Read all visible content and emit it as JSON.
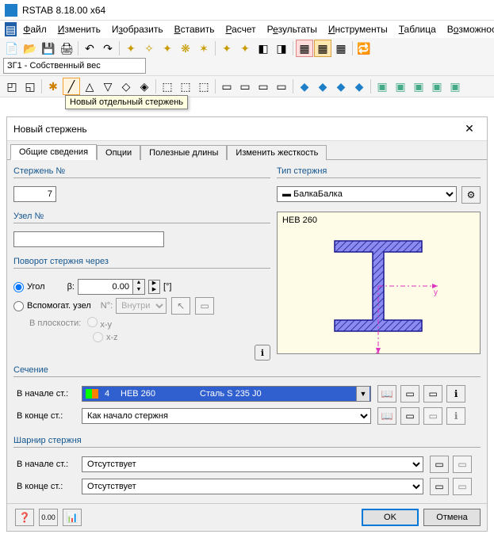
{
  "app": {
    "title": "RSTAB 8.18.00 x64"
  },
  "menu": [
    "Файл",
    "Изменить",
    "Изобразить",
    "Вставить",
    "Расчет",
    "Результаты",
    "Инструменты",
    "Таблица",
    "Возможности"
  ],
  "toolbar": {
    "loadcase": "ЗГ1 - Собственный вес",
    "tooltip": "Новый отдельный стержень"
  },
  "dialog": {
    "title": "Новый стержень",
    "tabs": [
      "Общие сведения",
      "Опции",
      "Полезные длины",
      "Изменить жесткость"
    ],
    "member_no_label": "Стержень №",
    "member_no": "7",
    "type_label": "Тип стержня",
    "type_value": "Балка",
    "node_label": "Узел №",
    "node_value": "",
    "preview_label": "HEB 260",
    "rotation_label": "Поворот стержня через",
    "angle_label": "Угол",
    "beta_label": "β:",
    "beta_value": "0.00",
    "beta_unit": "[°]",
    "helpnode_label": "Вспомогат. узел",
    "inside_label": "Внутри",
    "plane_label": "В плоскости:",
    "plane_xy": "x-y",
    "plane_xz": "x-z",
    "section_label": "Сечение",
    "start_label": "В начале ст.:",
    "end_label": "В конце ст.:",
    "section_start_num": "4",
    "section_start_name": "HEB 260",
    "section_start_mat": "Сталь S 235 J0",
    "section_end": "Как начало стержня",
    "hinge_label": "Шарнир стержня",
    "hinge_start": "Отсутствует",
    "hinge_end": "Отсутствует",
    "n_label": "N°:",
    "ok": "OK",
    "cancel": "Отмена"
  }
}
